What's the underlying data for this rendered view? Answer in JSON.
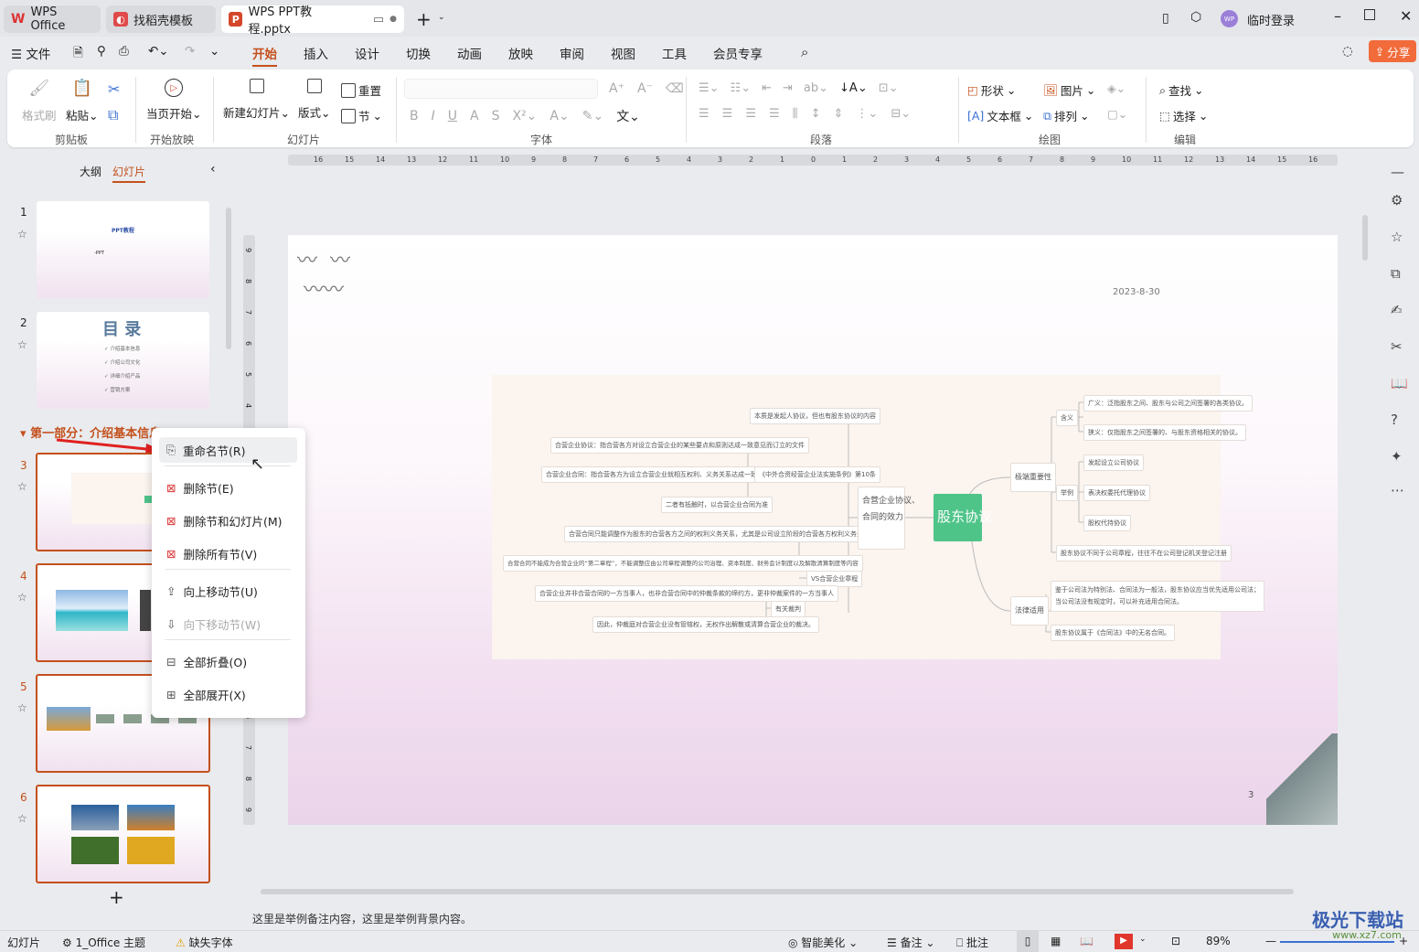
{
  "tabs": [
    {
      "label": "WPS Office",
      "icon": "wps-logo-icon"
    },
    {
      "label": "找稻壳模板",
      "icon": "docer-icon"
    },
    {
      "label": "WPS PPT教程.pptx",
      "icon": "ppt-file-icon"
    }
  ],
  "titlebar": {
    "user": "临时登录",
    "avatar": "WP"
  },
  "menu": {
    "file": "文件",
    "tabs": [
      "开始",
      "插入",
      "设计",
      "切换",
      "动画",
      "放映",
      "审阅",
      "视图",
      "工具",
      "会员专享"
    ],
    "active": "开始",
    "share": "分享"
  },
  "ribbon": {
    "format_painter": "格式刷",
    "paste": "粘贴",
    "clipboard": "剪贴板",
    "play_current": "当页开始",
    "slideshow_group": "开始放映",
    "new_slide": "新建幻灯片",
    "layout": "版式",
    "reset": "重置",
    "section": "节",
    "slides_group": "幻灯片",
    "font_group": "字体",
    "paragraph_group": "段落",
    "shape": "形状",
    "picture": "图片",
    "textbox": "文本框",
    "arrange": "排列",
    "drawing_group": "绘图",
    "find": "查找",
    "select": "选择",
    "edit_group": "编辑"
  },
  "panel": {
    "outline_tab": "大纲",
    "slides_tab": "幻灯片",
    "section_title": "第一部分：介绍基本信息",
    "add": "+"
  },
  "thumbs": {
    "s1_title": "PPT教程",
    "s1_sub": "-PPT",
    "s2_title": "目 录",
    "s2_items": [
      "介绍基本信息",
      "介绍公司文化",
      "详细介绍产品",
      "营销方案"
    ],
    "numbers": [
      "1",
      "2",
      "3",
      "4",
      "5",
      "6"
    ]
  },
  "context_menu": [
    {
      "label": "重命名节(R)",
      "icon": "rename-section-icon",
      "enabled": true
    },
    {
      "label": "删除节(E)",
      "icon": "delete-section-icon",
      "enabled": true
    },
    {
      "label": "删除节和幻灯片(M)",
      "icon": "delete-section-slides-icon",
      "enabled": true
    },
    {
      "label": "删除所有节(V)",
      "icon": "delete-all-sections-icon",
      "enabled": true
    },
    {
      "label": "向上移动节(U)",
      "icon": "move-up-icon",
      "enabled": true
    },
    {
      "label": "向下移动节(W)",
      "icon": "move-down-icon",
      "enabled": false
    },
    {
      "label": "全部折叠(O)",
      "icon": "collapse-all-icon",
      "enabled": true
    },
    {
      "label": "全部展开(X)",
      "icon": "expand-all-icon",
      "enabled": true
    }
  ],
  "ruler": [
    "16",
    "15",
    "14",
    "13",
    "12",
    "11",
    "10",
    "9",
    "8",
    "7",
    "6",
    "5",
    "4",
    "3",
    "2",
    "1",
    "0",
    "1",
    "2",
    "3",
    "4",
    "5",
    "6",
    "7",
    "8",
    "9",
    "10",
    "11",
    "12",
    "13",
    "14",
    "15",
    "16"
  ],
  "vruler": [
    "9",
    "8",
    "7",
    "6",
    "5",
    "4",
    "3",
    "2",
    "1",
    "0",
    "1",
    "2",
    "3",
    "4",
    "5",
    "6",
    "7",
    "8",
    "9"
  ],
  "slide": {
    "date": "2023-8-30",
    "page": "3",
    "mindmap": {
      "center": "股东协议",
      "n1": "本质是发起人协议，但也有股东协议的内容",
      "n2": "合营企业协议：指合营各方对设立合营企业的某些要点和原则达成一致意见而订立的文件",
      "n3": "合营企业合同：指合营各方为设立合营企业就相互权利、义务关系达成一致意见而订立的文件",
      "n4": "《中外合资经营企业法实施条例》第10条",
      "n5": "二者有抵触时，以合营企业合同为准",
      "n6": "合营合同只能调整作为股东的合营各方之间的权利义务关系，尤其是公司设立阶段的合营各方权利义务关系",
      "n7": "合营合同不能成为合营企业的“第二章程”，不能调整应由公司章程调整的公司治理、资本制度、财务会计制度以及解散清算制度等内容",
      "n8": "VS合营企业章程",
      "n9": "合营企业并非合营合同的一方当事人，也非合营合同中的仲裁条款的缔约方，更非仲裁案件的一方当事人",
      "n10": "有关裁判",
      "n11": "因此，仲裁庭对合营企业没有管辖权，无权作出解散或清算合营企业的裁决。",
      "n12a": "合营企业协议、",
      "n12b": "合同的效力",
      "r1": "极端重要性",
      "r2": "法律适用",
      "r3": "含义",
      "r4": "举例",
      "r5": "广义：泛指股东之间、股东与公司之间签署的各类协议。",
      "r6": "狭义：仅指股东之间签署的、与股东资格相关的协议。",
      "r7": "发起设立公司协议",
      "r8": "表决权委托代理协议",
      "r9": "股权代持协议",
      "r10": "股东协议不同于公司章程，往往不在公司登记机关登记注册",
      "r11a": "鉴于公司法为特别法、合同法为一般法，股东协议应当优先适用公司法；",
      "r11b": "当公司法没有规定时，可以补充适用合同法。",
      "r12": "股东协议属于《合同法》中的无名合同。"
    }
  },
  "notes": "这里是举例备注内容，这里是举例背景内容。",
  "status": {
    "slides": "幻灯片",
    "theme": "1_Office 主题",
    "missing_font": "缺失字体",
    "beautify": "智能美化",
    "notes": "备注",
    "comment": "批注",
    "zoom": "89%"
  },
  "watermark": {
    "text": "极光下载站",
    "url": "www.xz7.com"
  },
  "colors": {
    "accent": "#c4501c",
    "share": "#f26b3a",
    "mindmap_center": "#4fc489"
  }
}
